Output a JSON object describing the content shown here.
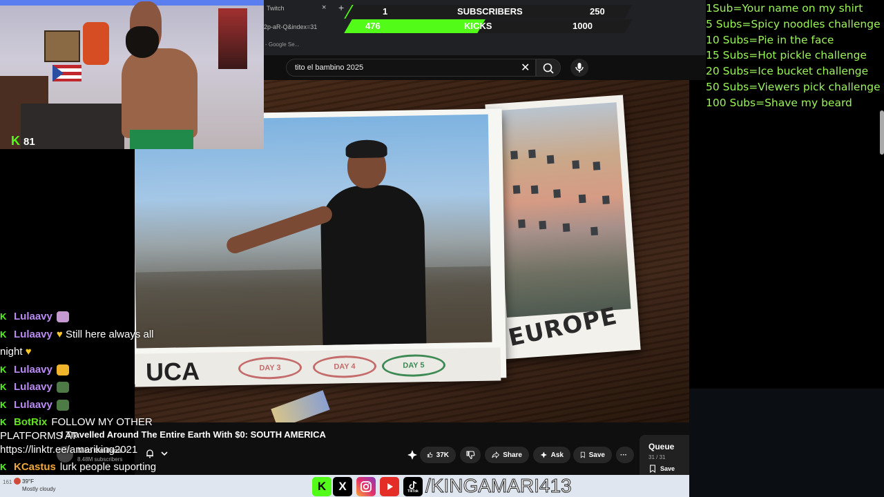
{
  "browser": {
    "tab_title": "Twitch",
    "tab_close": "×",
    "tab_new": "+",
    "url_fragment": "2p-aR-Q&index=31",
    "bookmark_fragment": "- Google Se..."
  },
  "youtube": {
    "search_value": "tito el bambino 2025",
    "search_clear": "✕",
    "video_title": "I Travelled Around The Entire Earth With $0: SOUTH AMERICA",
    "channel_name": "Niko Omilana",
    "channel_check": "✓",
    "channel_subs": "8.48M subscribers",
    "actions": {
      "like_count": "37K",
      "share": "Share",
      "ask": "Ask",
      "save": "Save",
      "more": "···"
    },
    "queue": {
      "title": "Queue",
      "count": "31 / 31",
      "save": "Save"
    },
    "video_overlay": {
      "europe": "EUROPE",
      "strip_letters": "UCA",
      "stamp_1": "DAY 3",
      "stamp_2": "DAY 4",
      "stamp_3": "DAY 5"
    }
  },
  "goal_bar": {
    "row1_left": "1",
    "row1_label": "SUBSCRIBERS",
    "row1_right": "250",
    "row2_left": "476",
    "row2_label": "KICKS",
    "row2_right": "1000",
    "subs_progress": 0.004,
    "kicks_progress": 0.476
  },
  "subgoals": [
    "1Sub=Your name on my shirt",
    "5 Subs=Spicy noodles challenge",
    "10 Subs=Pie in the face",
    "15 Subs=Hot pickle challenge",
    "20 Subs=Ice bucket challenge",
    "50 Subs=Viewers pick challenge",
    "100 Subs=Shave my beard"
  ],
  "webcam": {
    "kick_k": "K",
    "viewer_count": "81"
  },
  "chat": {
    "badge": "K",
    "messages": [
      {
        "user": "Lulaavy",
        "text": ""
      },
      {
        "user": "Lulaavy",
        "text": "Still here always all"
      },
      {
        "user": "",
        "text": "night"
      },
      {
        "user": "Lulaavy",
        "text": ""
      },
      {
        "user": "Lulaavy",
        "text": ""
      },
      {
        "user": "Lulaavy",
        "text": ""
      },
      {
        "user": "BotRix",
        "text": "FOLLOW MY OTHER"
      },
      {
        "user": "",
        "text": "PLATFORMS AT"
      },
      {
        "user": "",
        "text": "https://linktr.ee/amariking2021"
      },
      {
        "user": "KCastus",
        "text": "lurk people suporting"
      }
    ]
  },
  "taskbar": {
    "weather_temp": "39°F",
    "weather_desc": "Mostly cloudy",
    "weather_num": "161"
  },
  "social": {
    "kick": "K",
    "x": "X",
    "tiktok_label": "TikTok",
    "handle": "/KINGAMARI413"
  },
  "colors": {
    "kick_green": "#53fc18",
    "goal_text": "#9cf55a",
    "chat_user_purple": "#b98cf2"
  }
}
